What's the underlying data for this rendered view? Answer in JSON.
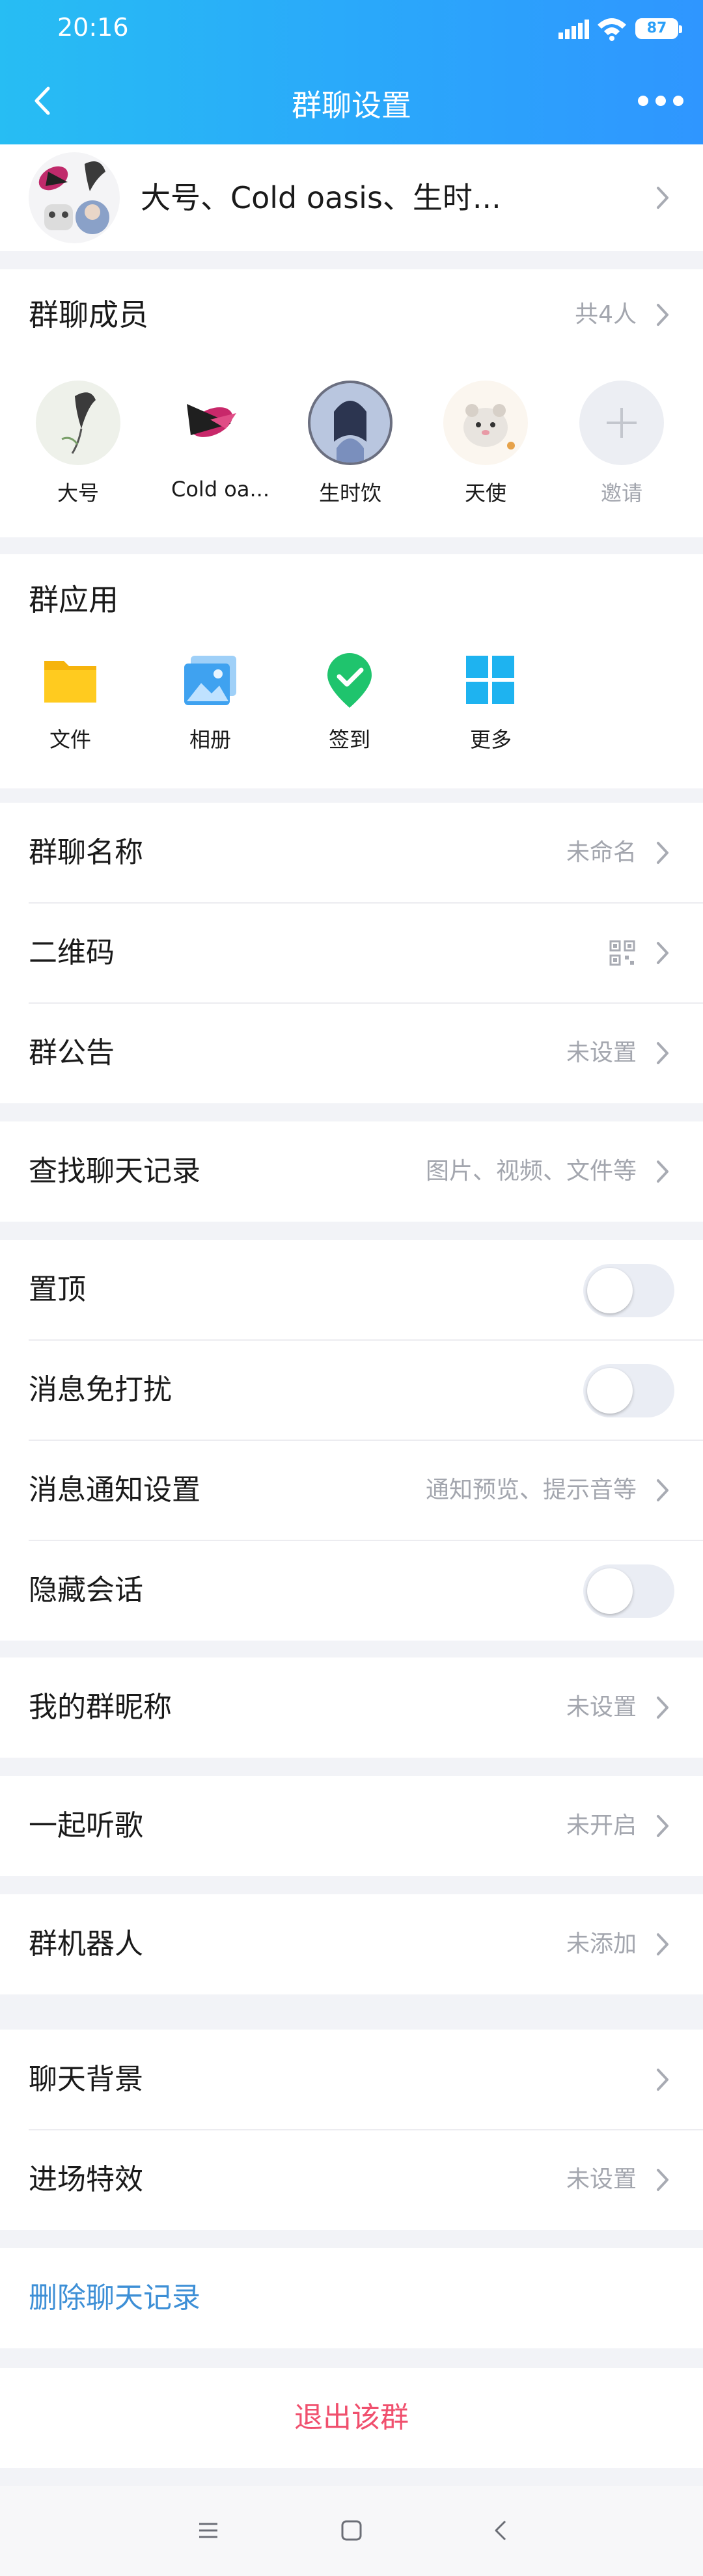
{
  "status": {
    "time": "20:16",
    "battery": "87"
  },
  "nav": {
    "title": "群聊设置"
  },
  "group": {
    "name_line": "大号、Cold oasis、生时..."
  },
  "members": {
    "label": "群聊成员",
    "count": "共4人",
    "items": [
      {
        "name": "大号"
      },
      {
        "name": "Cold oa..."
      },
      {
        "name": "生时饮"
      },
      {
        "name": "天使"
      }
    ],
    "invite_label": "邀请"
  },
  "apps": {
    "label": "群应用",
    "items": [
      {
        "name": "文件",
        "icon": "folder-icon"
      },
      {
        "name": "相册",
        "icon": "album-icon"
      },
      {
        "name": "签到",
        "icon": "checkin-icon"
      },
      {
        "name": "更多",
        "icon": "more-apps-icon"
      }
    ]
  },
  "settings": {
    "group_name": {
      "label": "群聊名称",
      "value": "未命名"
    },
    "qr_code": {
      "label": "二维码"
    },
    "announcement": {
      "label": "群公告",
      "value": "未设置"
    },
    "search_history": {
      "label": "查找聊天记录",
      "value": "图片、视频、文件等"
    },
    "pin": {
      "label": "置顶",
      "on": false
    },
    "mute": {
      "label": "消息免打扰",
      "on": false
    },
    "notify": {
      "label": "消息通知设置",
      "value": "通知预览、提示音等"
    },
    "hide": {
      "label": "隐藏会话",
      "on": false
    },
    "nickname": {
      "label": "我的群昵称",
      "value": "未设置"
    },
    "listen": {
      "label": "一起听歌",
      "value": "未开启"
    },
    "robot": {
      "label": "群机器人",
      "value": "未添加"
    },
    "background": {
      "label": "聊天背景"
    },
    "entry_effect": {
      "label": "进场特效",
      "value": "未设置"
    },
    "delete_history": {
      "label": "删除聊天记录"
    },
    "exit": {
      "label": "退出该群"
    }
  },
  "colors": {
    "accent": "#2aa9fa",
    "link_blue": "#3d8fd6",
    "danger": "#f0506e"
  }
}
